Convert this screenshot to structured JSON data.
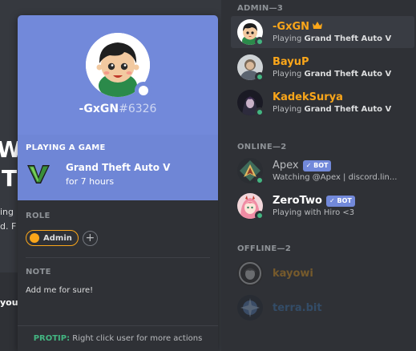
{
  "background": {
    "fragments": [
      "W",
      "T",
      "ing",
      "d. F",
      "your"
    ]
  },
  "profile": {
    "name": "-GxGN",
    "discriminator": "#6326",
    "game_section_title": "PLAYING A GAME",
    "game_name": "Grand Theft Auto V",
    "game_time": "for 7 hours",
    "role_title": "ROLE",
    "role_name": "Admin",
    "role_color": "#faa61a",
    "note_title": "NOTE",
    "note_text": "Add me for sure!",
    "protip_label": "PROTIP:",
    "protip_text": " Right click user for more actions"
  },
  "members": {
    "groups": [
      {
        "title": "ADMIN—3"
      },
      {
        "title": "ONLINE—2"
      },
      {
        "title": "OFFLINE—2"
      }
    ],
    "admin": [
      {
        "name": "-GxGN",
        "color": "#faa61a",
        "activity_prefix": "Playing ",
        "activity_bold": "Grand Theft Auto V"
      },
      {
        "name": "BayuP",
        "color": "#faa61a",
        "activity_prefix": "Playing ",
        "activity_bold": "Grand Theft Auto V"
      },
      {
        "name": "KadekSurya",
        "color": "#faa61a",
        "activity_prefix": "Playing ",
        "activity_bold": "Grand Theft Auto V"
      }
    ],
    "online": [
      {
        "name": "Apex",
        "color": "#b9bbbe",
        "tag": "BOT",
        "activity_prefix": "Watching @Apex | discord.lin...",
        "activity_bold": ""
      },
      {
        "name": "ZeroTwo",
        "color": "#ffffff",
        "tag": "BOT",
        "activity_prefix": "Playing with Hiro <3",
        "activity_bold": ""
      }
    ],
    "offline": [
      {
        "name": "kayowi",
        "color": "#faa61a"
      },
      {
        "name": "terra.bit",
        "color": "#3b7fc4"
      }
    ]
  },
  "colors": {
    "blurple": "#7289da",
    "online": "#43b581"
  }
}
